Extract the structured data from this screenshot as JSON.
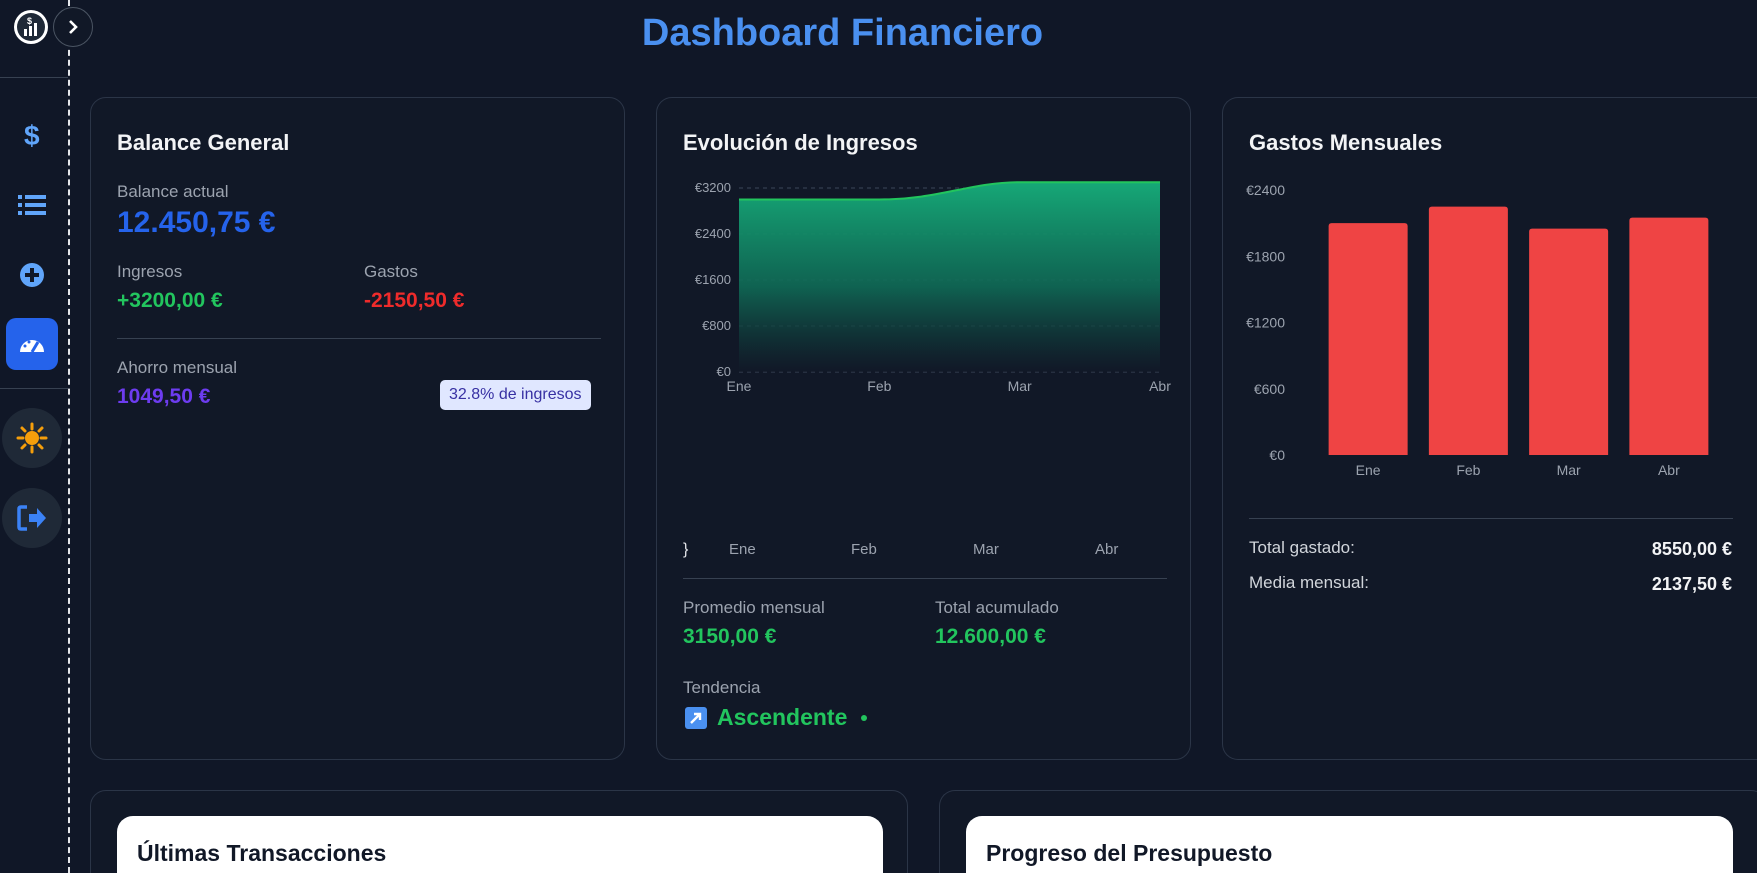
{
  "page_title": "Dashboard Financiero",
  "sidebar": {
    "logo_icon": "finance-logo-icon",
    "items": [
      {
        "name": "dollar-icon",
        "active": false
      },
      {
        "name": "list-icon",
        "active": false
      },
      {
        "name": "add-circle-icon",
        "active": false
      },
      {
        "name": "dashboard-gauge-icon",
        "active": true
      }
    ],
    "theme_icon": "sun-icon",
    "logout_icon": "logout-icon"
  },
  "balance": {
    "title": "Balance General",
    "current_label": "Balance actual",
    "current_value": "12.450,75 €",
    "income_label": "Ingresos",
    "income_value": "+3200,00 €",
    "expense_label": "Gastos",
    "expense_value": "-2150,50 €",
    "savings_label": "Ahorro mensual",
    "savings_value": "1049,50 €",
    "savings_badge": "32.8% de ingresos"
  },
  "income": {
    "title": "Evolución de Ingresos",
    "months_bottom": [
      "Ene",
      "Feb",
      "Mar",
      "Abr"
    ],
    "avg_label": "Promedio mensual",
    "avg_value": "3150,00 €",
    "total_label": "Total acumulado",
    "total_value": "12.600,00 €",
    "trend_label": "Tendencia",
    "trend_value": "Ascendente",
    "trend_icon": "arrow-up-right-icon"
  },
  "expenses": {
    "title": "Gastos Mensuales",
    "total_label": "Total gastado:",
    "total_value": "8550,00 €",
    "avg_label": "Media mensual:",
    "avg_value": "2137,50 €"
  },
  "transactions": {
    "title": "Últimas Transacciones"
  },
  "budget": {
    "title": "Progreso del Presupuesto"
  },
  "colors": {
    "accent": "#4a90f0",
    "income": "#22c55e",
    "expense": "#ef4444",
    "savings": "#6d3cf0"
  },
  "chart_data": [
    {
      "type": "area",
      "x": [
        "Ene",
        "Feb",
        "Mar",
        "Abr"
      ],
      "series": [
        {
          "values": [
            3000,
            3000,
            3300,
            3300
          ]
        }
      ],
      "yticks": [
        "€0",
        "€800",
        "€1600",
        "€2400",
        "€3200"
      ],
      "ylim": [
        0,
        3200
      ],
      "grid": true
    },
    {
      "type": "bar",
      "categories": [
        "Ene",
        "Feb",
        "Mar",
        "Abr"
      ],
      "values": [
        2100,
        2250,
        2050,
        2150
      ],
      "yticks": [
        "€0",
        "€600",
        "€1200",
        "€1800",
        "€2400"
      ],
      "ylim": [
        0,
        2400
      ],
      "grid": false
    }
  ]
}
